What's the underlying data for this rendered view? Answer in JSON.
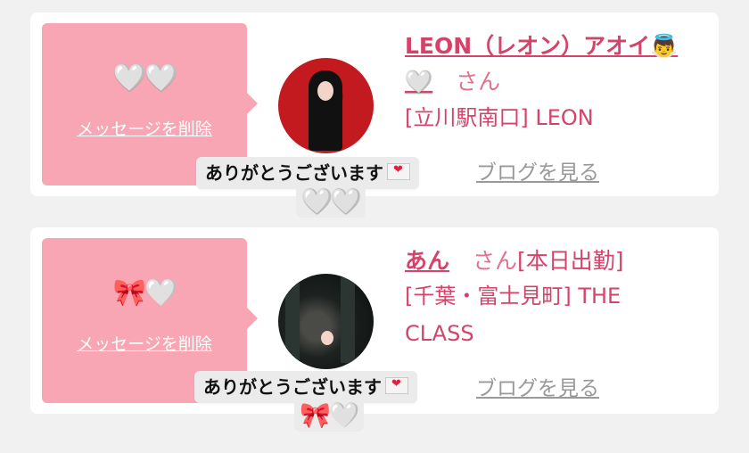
{
  "messages": [
    {
      "stamp": "🤍🤍",
      "delete_label": "メッセージを削除",
      "name": "LEON（レオン）アオイ👼",
      "name_suffix": "🤍",
      "honorific": "さん",
      "shop": "[立川駅南口] LEON",
      "blog_label": "ブログを見る",
      "toast_text": "ありがとうございます",
      "reaction": "🤍🤍"
    },
    {
      "stamp": "🎀🤍",
      "delete_label": "メッセージを削除",
      "name": "あん",
      "honorific": "さん",
      "status": "[本日出勤]",
      "shop": "[千葉・富士見町] THE CLASS",
      "blog_label": "ブログを見る",
      "toast_text": "ありがとうございます",
      "reaction": "🎀🤍"
    }
  ],
  "colors": {
    "accent": "#d4436a",
    "pink_box": "#f8a5b4",
    "background": "#f1f1f1"
  }
}
